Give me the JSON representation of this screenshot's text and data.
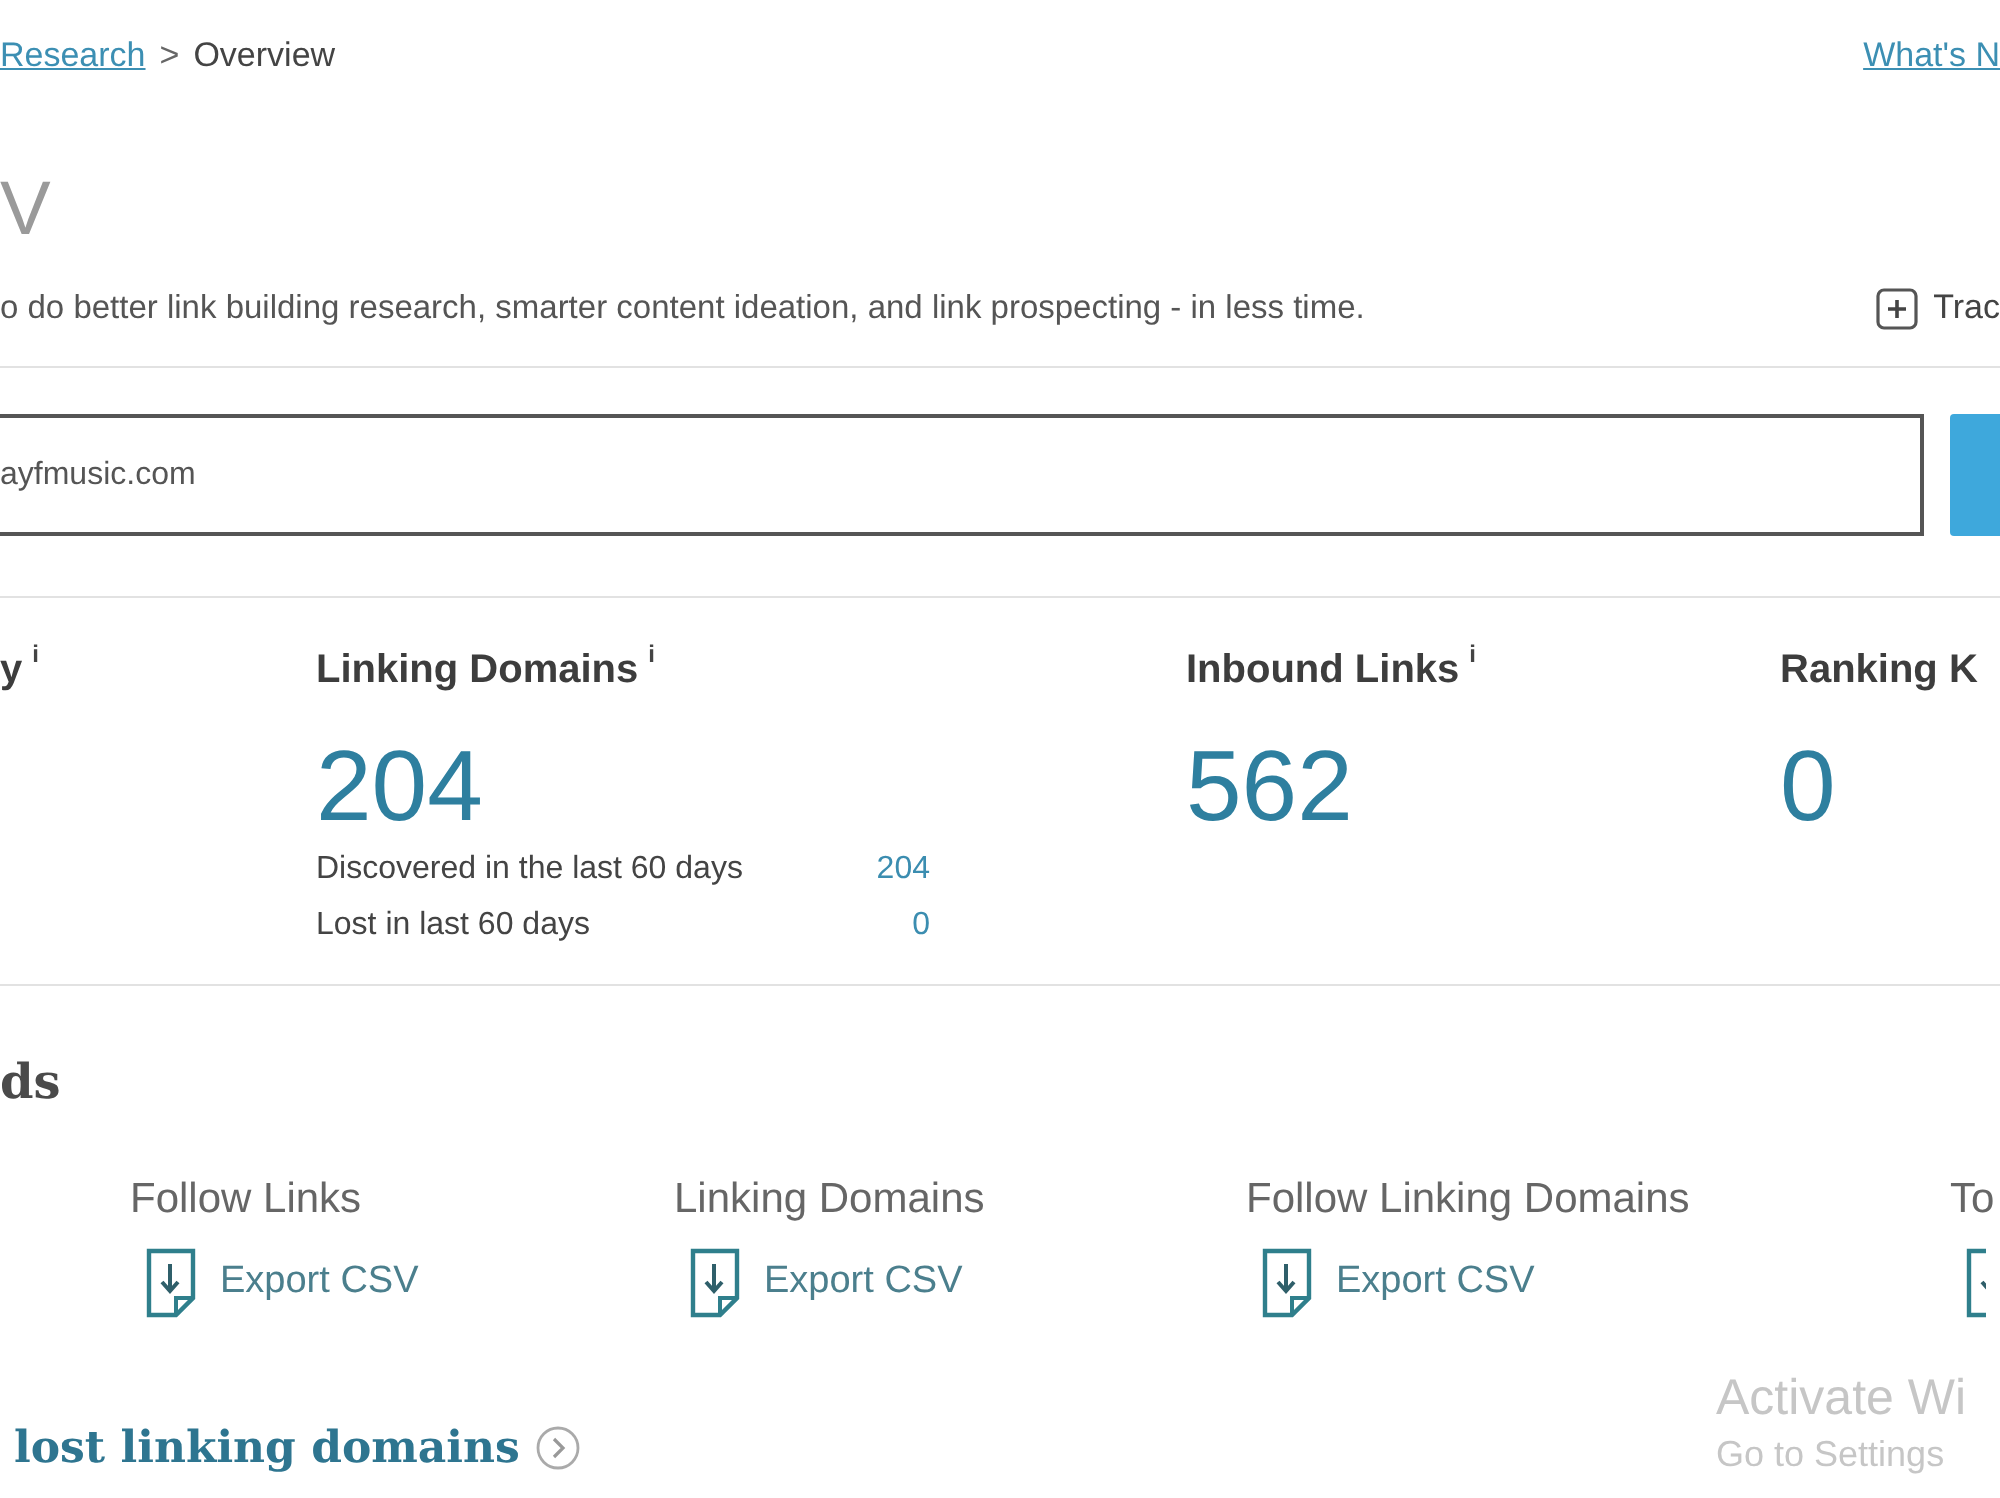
{
  "breadcrumb": [
    {
      "kind": "link",
      "label": "Research"
    },
    {
      "kind": "separator",
      "label": ">"
    },
    {
      "kind": "current",
      "label": "Overview"
    }
  ],
  "header_link": "What's N",
  "title": "V",
  "description": "o do better link building research, smarter content ideation, and link prospecting - in less time.",
  "track_button": {
    "label": "Trac"
  },
  "search": {
    "value": "ayfmusic.com"
  },
  "metrics": [
    {
      "label": "y",
      "info": "i"
    },
    {
      "label": "Linking Domains",
      "info": "i",
      "value": "204",
      "details": [
        {
          "label": "Discovered in the last 60 days",
          "value": "204"
        },
        {
          "label": "Lost in last 60 days",
          "value": "0"
        }
      ]
    },
    {
      "label": "Inbound Links",
      "info": "i",
      "value": "562"
    },
    {
      "label": "Ranking K",
      "value": "0"
    }
  ],
  "downloads": {
    "title": "ds",
    "items": [
      {
        "label": "Follow Links",
        "action": "Export CSV"
      },
      {
        "label": "Linking Domains",
        "action": "Export CSV"
      },
      {
        "label": "Follow Linking Domains",
        "action": "Export CSV"
      },
      {
        "label": "To"
      }
    ]
  },
  "lost_domains": {
    "title": "lost linking domains"
  },
  "activation_notice": {
    "title": "Activate Wi",
    "subtitle": "Go to Settings"
  }
}
